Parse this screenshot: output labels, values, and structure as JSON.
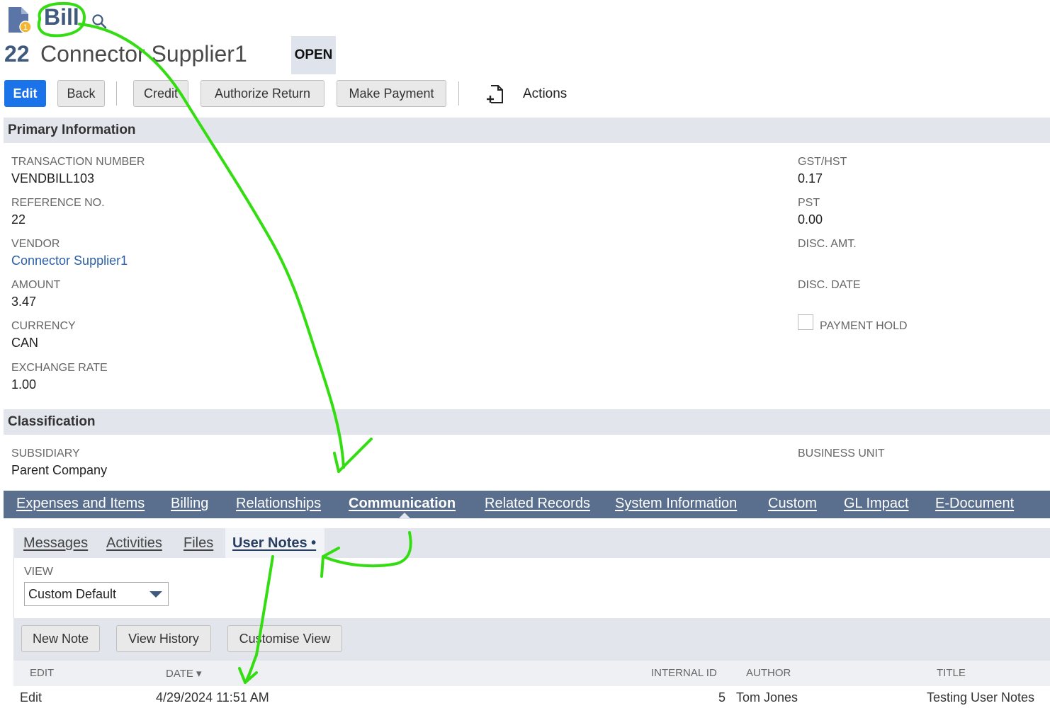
{
  "header": {
    "record_type": "Bill",
    "record_number": "22",
    "record_name": "Connector Supplier1",
    "status": "OPEN"
  },
  "toolbar": {
    "edit": "Edit",
    "back": "Back",
    "credit": "Credit",
    "authorize_return": "Authorize Return",
    "make_payment": "Make Payment",
    "actions": "Actions"
  },
  "primary": {
    "title": "Primary Information",
    "left": [
      {
        "label": "TRANSACTION NUMBER",
        "value": "VENDBILL103"
      },
      {
        "label": "REFERENCE NO.",
        "value": "22"
      },
      {
        "label": "VENDOR",
        "value": "Connector Supplier1"
      },
      {
        "label": "AMOUNT",
        "value": "3.47"
      },
      {
        "label": "CURRENCY",
        "value": "CAN"
      },
      {
        "label": "EXCHANGE RATE",
        "value": "1.00"
      }
    ],
    "right": [
      {
        "label": "GST/HST",
        "value": "0.17"
      },
      {
        "label": "PST",
        "value": "0.00"
      },
      {
        "label": "DISC. AMT.",
        "value": ""
      },
      {
        "label": "DISC. DATE",
        "value": ""
      }
    ],
    "payment_hold": {
      "label": "PAYMENT HOLD",
      "checked": false
    }
  },
  "classification": {
    "title": "Classification",
    "subsidiary_label": "SUBSIDIARY",
    "subsidiary_value": "Parent Company",
    "business_unit_label": "BUSINESS UNIT"
  },
  "tabs": [
    {
      "label": "Expenses and Items"
    },
    {
      "label": "Billing"
    },
    {
      "label": "Relationships"
    },
    {
      "label": "Communication",
      "active": true
    },
    {
      "label": "Related Records"
    },
    {
      "label": "System Information"
    },
    {
      "label": "Custom"
    },
    {
      "label": "GL Impact"
    },
    {
      "label": "E-Document"
    }
  ],
  "subtabs": [
    {
      "label": "Messages"
    },
    {
      "label": "Activities"
    },
    {
      "label": "Files"
    },
    {
      "label": "User Notes •",
      "active": true
    }
  ],
  "notes": {
    "view_label": "VIEW",
    "view_value": "Custom Default",
    "buttons": {
      "new_note": "New Note",
      "view_history": "View History",
      "customise_view": "Customise View"
    },
    "columns": {
      "edit": "EDIT",
      "date": "DATE ▾",
      "internal_id": "INTERNAL ID",
      "author": "AUTHOR",
      "title": "TITLE"
    },
    "rows": [
      {
        "edit": "Edit",
        "date": "4/29/2024 11:51 AM",
        "internal_id": "5",
        "author": "Tom Jones",
        "title": "Testing User Notes"
      }
    ]
  },
  "colors": {
    "primary_button": "#1a73e8",
    "tab_bar": "#5a6f8d",
    "section_header": "#e2e6ec",
    "annotation": "#33dd11"
  }
}
